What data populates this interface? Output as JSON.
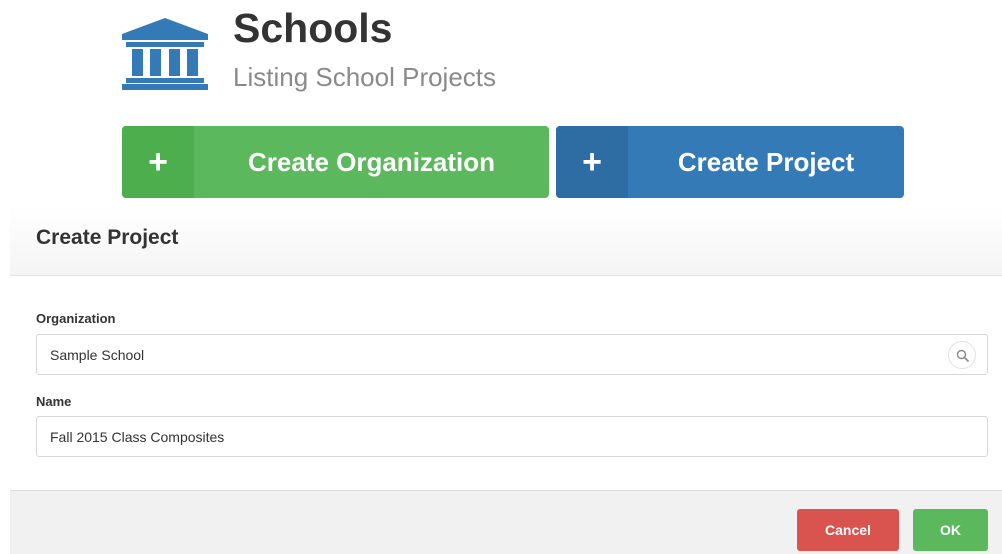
{
  "header": {
    "icon": "bank-building-icon",
    "title": "Schools",
    "subtitle": "Listing School Projects"
  },
  "actions": {
    "create_organization": {
      "icon": "plus-icon",
      "plus": "+",
      "label": "Create Organization",
      "color": "#5cb85c"
    },
    "create_project": {
      "icon": "plus-icon",
      "plus": "+",
      "label": "Create Project",
      "color": "#337ab7"
    }
  },
  "modal": {
    "title": "Create Project",
    "fields": {
      "organization": {
        "label": "Organization",
        "value": "Sample School",
        "icon": "search-icon"
      },
      "name": {
        "label": "Name",
        "value": "Fall 2015 Class Composites"
      }
    },
    "footer": {
      "cancel_label": "Cancel",
      "cancel_color": "#d9534f",
      "ok_label": "OK",
      "ok_color": "#5cb85c"
    }
  }
}
